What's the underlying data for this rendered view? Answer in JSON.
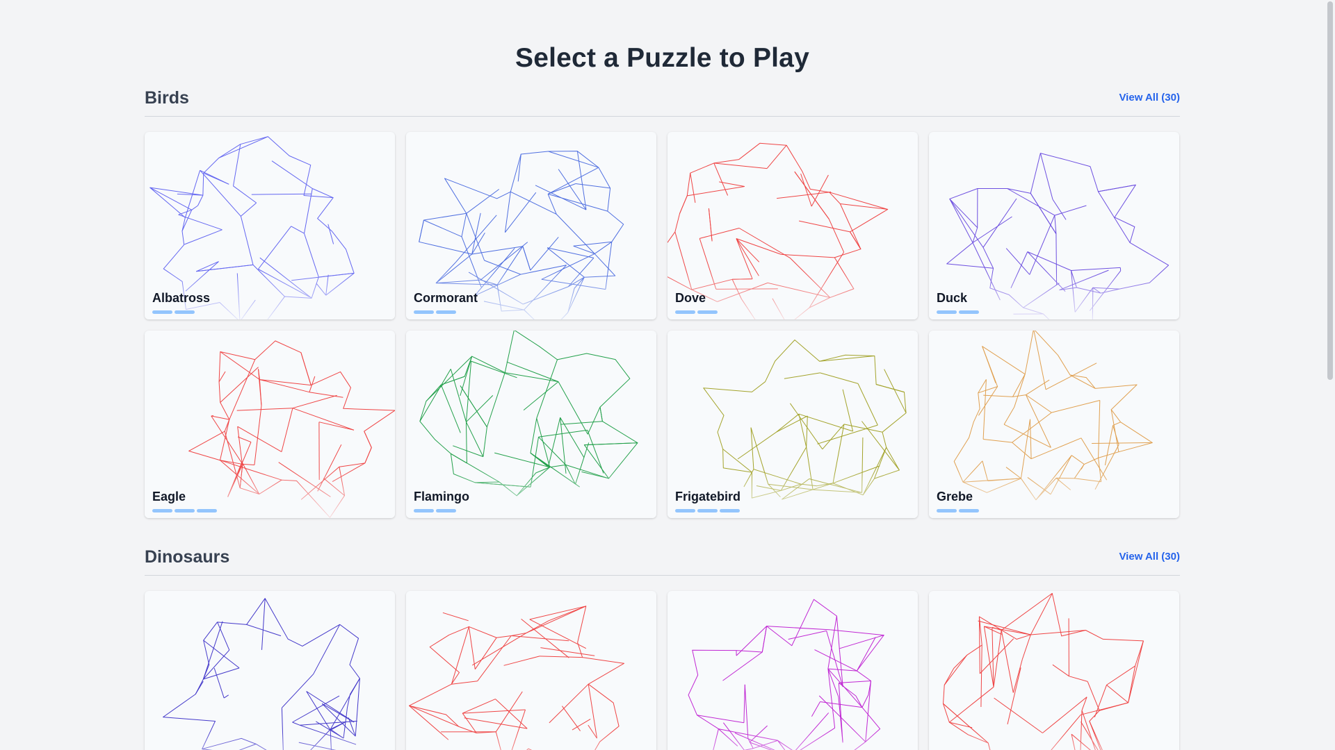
{
  "page": {
    "title": "Select a Puzzle to Play"
  },
  "sections": [
    {
      "title": "Birds",
      "view_all": "View All (30)",
      "puzzles": [
        {
          "name": "Albatross",
          "color": "#6366f1",
          "progress": 2,
          "icon": "albatross-art"
        },
        {
          "name": "Cormorant",
          "color": "#4f6fe0",
          "progress": 2,
          "icon": "cormorant-art"
        },
        {
          "name": "Dove",
          "color": "#ef4444",
          "progress": 2,
          "icon": "dove-art"
        },
        {
          "name": "Duck",
          "color": "#6d4fe0",
          "progress": 2,
          "icon": "duck-art"
        },
        {
          "name": "Eagle",
          "color": "#ef4444",
          "progress": 3,
          "icon": "eagle-art"
        },
        {
          "name": "Flamingo",
          "color": "#22a04a",
          "progress": 2,
          "icon": "flamingo-art"
        },
        {
          "name": "Frigatebird",
          "color": "#a3a32a",
          "progress": 3,
          "icon": "frigatebird-art"
        },
        {
          "name": "Grebe",
          "color": "#e0a050",
          "progress": 2,
          "icon": "grebe-art"
        }
      ]
    },
    {
      "title": "Dinosaurs",
      "view_all": "View All (30)",
      "puzzles": [
        {
          "name": "",
          "color": "#4338ca",
          "progress": 0,
          "icon": "ankylosaurus-art"
        },
        {
          "name": "",
          "color": "#ef4444",
          "progress": 0,
          "icon": "baryonyx-art"
        },
        {
          "name": "",
          "color": "#c026d3",
          "progress": 0,
          "icon": "brachiosaurus-art"
        },
        {
          "name": "",
          "color": "#ef4444",
          "progress": 0,
          "icon": "carnotaurus-art"
        }
      ]
    }
  ]
}
